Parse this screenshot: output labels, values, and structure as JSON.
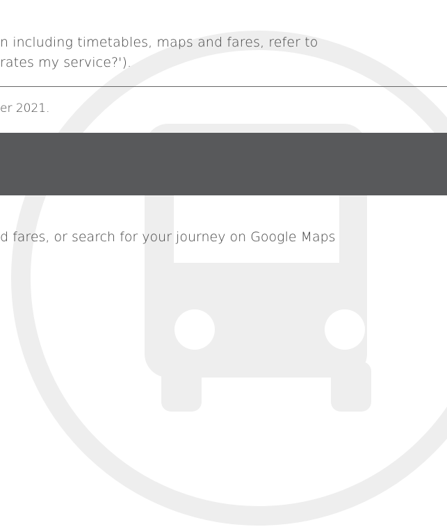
{
  "intro": {
    "line1": "n including timetables, maps and fares, refer to",
    "line2": "rates my service?')."
  },
  "updated_text": "er 2021.",
  "journey_text": "d fares, or search for your journey on Google Maps",
  "colors": {
    "banner": "#58595b",
    "watermark": "#f0f0f0",
    "text": "#3f3f3f"
  },
  "watermark_icon": "bus-icon"
}
